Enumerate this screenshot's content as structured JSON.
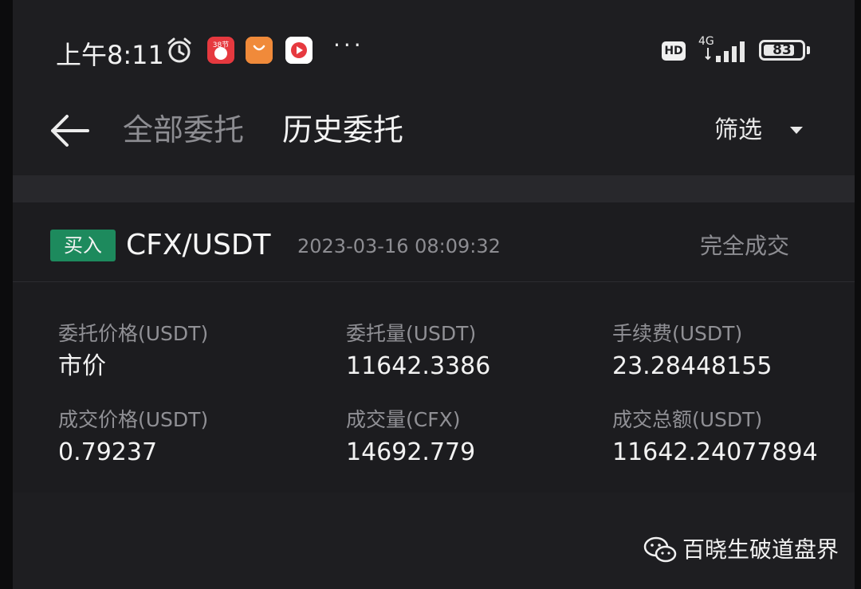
{
  "status_bar": {
    "time": "上午8:11",
    "app_badge_text": "38节",
    "more": "···",
    "hd": "HD",
    "network": "4G",
    "battery": "83",
    "battery_fraction": 0.83
  },
  "header": {
    "tabs": [
      {
        "label": "全部委托",
        "active": false
      },
      {
        "label": "历史委托",
        "active": true
      }
    ],
    "filter_label": "筛选"
  },
  "order": {
    "side": "买入",
    "pair": "CFX/USDT",
    "datetime": "2023-03-16 08:09:32",
    "status": "完全成交",
    "fields": [
      {
        "label": "委托价格(USDT)",
        "value": "市价"
      },
      {
        "label": "委托量(USDT)",
        "value": "11642.3386"
      },
      {
        "label": "手续费(USDT)",
        "value": "23.28448155"
      },
      {
        "label": "成交价格(USDT)",
        "value": "0.79237"
      },
      {
        "label": "成交量(CFX)",
        "value": "14692.779"
      },
      {
        "label": "成交总额(USDT)",
        "value": "11642.24077894"
      }
    ]
  },
  "watermark": {
    "text": "百晓生破道盘界"
  },
  "colors": {
    "background": "#1e1e21",
    "buy_badge": "#1d8a5d",
    "text_primary": "#f2f2f2",
    "text_secondary": "#8d8d92"
  }
}
